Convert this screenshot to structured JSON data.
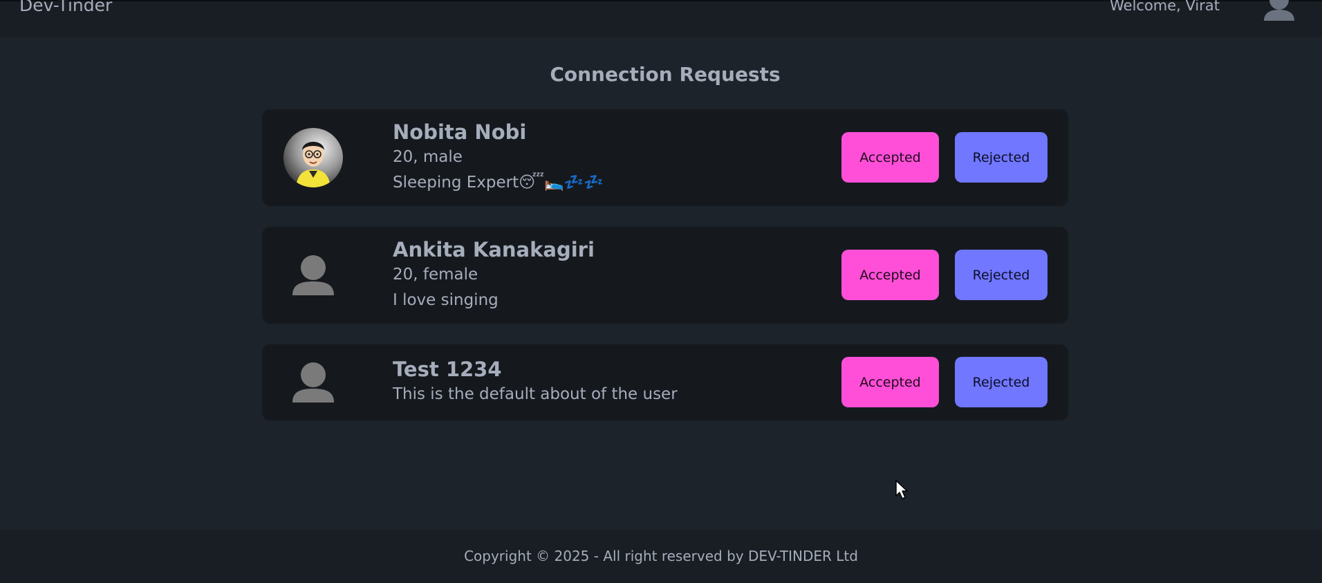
{
  "navbar": {
    "brand": "Dev-Tinder",
    "welcome": "Welcome, Virat"
  },
  "page": {
    "title": "Connection Requests"
  },
  "requests": [
    {
      "name": "Nobita Nobi",
      "details": "20, male",
      "about": "Sleeping Expert😴🛌💤💤",
      "avatar": "cartoon-photo",
      "accept_label": "Accepted",
      "reject_label": "Rejected"
    },
    {
      "name": "Ankita Kanakagiri",
      "details": "20, female",
      "about": "I love singing",
      "avatar": "default-user-icon",
      "accept_label": "Accepted",
      "reject_label": "Rejected"
    },
    {
      "name": "Test 1234",
      "about": "This is the default about of the user",
      "avatar": "default-user-icon",
      "accept_label": "Accepted",
      "reject_label": "Rejected"
    }
  ],
  "footer": {
    "text": "Copyright © 2025 - All right reserved by DEV-TINDER Ltd"
  },
  "colors": {
    "accept": "#ff4fd8",
    "reject": "#7177ff",
    "background": "#1d232a",
    "card": "#15191e"
  }
}
